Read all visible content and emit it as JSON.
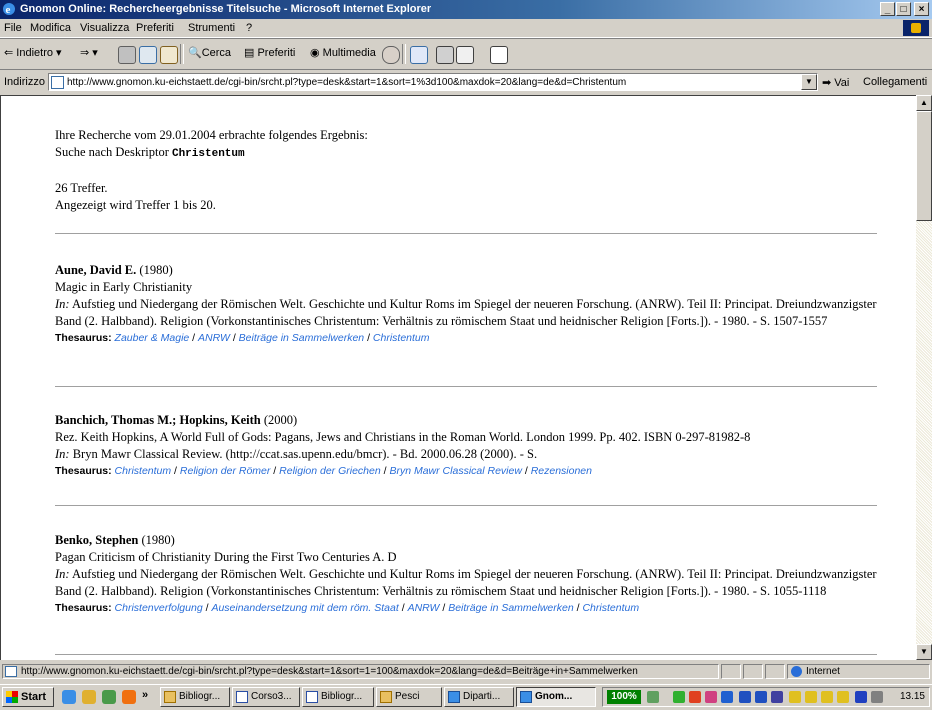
{
  "window": {
    "title": "Gnomon Online: Rechercheergebnisse Titelsuche - Microsoft Internet Explorer",
    "minimize": "_",
    "maximize": "□",
    "close": "×"
  },
  "menu": [
    "File",
    "Modifica",
    "Visualizza",
    "Preferiti",
    "Strumenti",
    "?"
  ],
  "toolbar": {
    "back": "Indietro",
    "search": "Cerca",
    "favorites": "Preferiti",
    "multimedia": "Multimedia"
  },
  "address": {
    "label": "Indirizzo",
    "url": "http://www.gnomon.ku-eichstaett.de/cgi-bin/srcht.pl?type=desk&start=1&sort=1%3d100&maxdok=20&lang=de&d=Christentum",
    "go": "Vai",
    "links": "Collegamenti"
  },
  "results": {
    "intro": "Ihre Recherche vom 29.01.2004 erbrachte folgendes Ergebnis:",
    "search_prefix": "Suche nach Deskriptor",
    "search_term": "Christentum",
    "hits": "26 Treffer.",
    "shown": "Angezeigt wird Treffer 1 bis 20."
  },
  "thesaurus_label": "Thesaurus:",
  "in_label": "In:",
  "entries": [
    {
      "author": "Aune, David E.",
      "year": "(1980)",
      "title": "Magic in Early Christianity",
      "source": "Aufstieg und Niedergang der Römischen Welt. Geschichte und Kultur Roms im Spiegel der neueren Forschung. (ANRW). Teil II: Principat. Dreiundzwanzigster Band (2. Halbband). Religion (Vorkonstantinisches Christentum: Verhältnis zu römischem Staat und heidnischer Religion [Forts.]). - 1980. - S. 1507-1557",
      "thesaurus": [
        "Zauber & Magie",
        "ANRW",
        "Beiträge in Sammelwerken",
        "Christentum"
      ]
    },
    {
      "author": "Banchich, Thomas M.; Hopkins, Keith",
      "year": "(2000)",
      "title": "Rez. Keith Hopkins, A World Full of Gods: Pagans, Jews and Christians in the Roman World. London 1999. Pp. 402. ISBN 0-297-81982-8",
      "source": "Bryn Mawr Classical Review. (http://ccat.sas.upenn.edu/bmcr). - Bd. 2000.06.28 (2000). - S.",
      "thesaurus": [
        "Christentum",
        "Religion der Römer",
        "Religion der Griechen",
        "Bryn Mawr Classical Review",
        "Rezensionen"
      ]
    },
    {
      "author": "Benko, Stephen",
      "year": "(1980)",
      "title": "Pagan Criticism of Christianity During the First Two Centuries A. D",
      "source": "Aufstieg und Niedergang der Römischen Welt. Geschichte und Kultur Roms im Spiegel der neueren Forschung. (ANRW). Teil II: Principat. Dreiundzwanzigster Band (2. Halbband). Religion (Vorkonstantinisches Christentum: Verhältnis zu römischem Staat und heidnischer Religion [Forts.]). - 1980. - S. 1055-1118",
      "thesaurus": [
        "Christenverfolgung",
        "Auseinandersetzung mit dem röm. Staat",
        "ANRW",
        "Beiträge in Sammelwerken",
        "Christentum"
      ]
    }
  ],
  "status": {
    "url": "http://www.gnomon.ku-eichstaett.de/cgi-bin/srcht.pl?type=desk&start=1&sort=1=100&maxdok=20&lang=de&d=Beiträge+in+Sammelwerken",
    "zone": "Internet"
  },
  "taskbar": {
    "start": "Start",
    "chevron": "»",
    "buttons": [
      "Bibliogr...",
      "Corso3...",
      "Bibliogr...",
      "Pesci",
      "Diparti...",
      "Gnom..."
    ],
    "zoom": "100%",
    "clock": "13.15"
  }
}
